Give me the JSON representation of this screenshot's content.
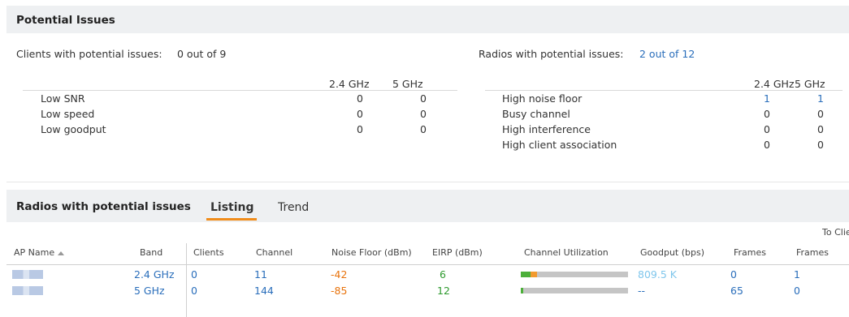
{
  "top": {
    "title": "Potential Issues",
    "clients_label": "Clients with potential issues:",
    "clients_value": "0 out of 9",
    "radios_label": "Radios with potential issues:",
    "radios_value": "2 out of 12",
    "clients_table": {
      "headers": [
        "2.4 GHz",
        "5 GHz"
      ],
      "rows": [
        {
          "label": "Low SNR",
          "v24": "0",
          "v5": "0"
        },
        {
          "label": "Low speed",
          "v24": "0",
          "v5": "0"
        },
        {
          "label": "Low goodput",
          "v24": "0",
          "v5": "0"
        }
      ]
    },
    "radios_table": {
      "headers": [
        "2.4 GHz",
        "5 GHz"
      ],
      "rows": [
        {
          "label": "High noise floor",
          "v24": "1",
          "v5": "1"
        },
        {
          "label": "Busy channel",
          "v24": "0",
          "v5": "0"
        },
        {
          "label": "High interference",
          "v24": "0",
          "v5": "0"
        },
        {
          "label": "High client association",
          "v24": "0",
          "v5": "0"
        }
      ]
    }
  },
  "bottom": {
    "title": "Radios with potential issues",
    "tabs": [
      "Listing",
      "Trend"
    ],
    "active_tab": "Listing",
    "to_clients_label": "To Clie",
    "columns": [
      "AP Name",
      "Band",
      "Clients",
      "Channel",
      "Noise Floor (dBm)",
      "EIRP (dBm)",
      "Channel Utilization",
      "Goodput (bps)",
      "Frames",
      "Frames"
    ],
    "rows": [
      {
        "band": "2.4 GHz",
        "clients": "0",
        "channel": "11",
        "noise_floor": "-42",
        "eirp": "6",
        "util_green": 0.09,
        "util_orange": 0.06,
        "goodput": "809.5 K",
        "frames1": "0",
        "frames2": "1"
      },
      {
        "band": "5 GHz",
        "clients": "0",
        "channel": "144",
        "noise_floor": "-85",
        "eirp": "12",
        "util_green": 0.02,
        "util_orange": 0.0,
        "goodput": "--",
        "frames1": "65",
        "frames2": "0"
      }
    ]
  },
  "colors": {
    "link": "#2a6ebb",
    "noise_floor": "#e8730c",
    "eirp": "#2e9a2e",
    "goodput_high": "#7fc6ec",
    "tab_accent": "#f08c1a",
    "util_green": "#4caf3a",
    "util_orange": "#f29a2e",
    "util_bg": "#c5c5c5"
  }
}
